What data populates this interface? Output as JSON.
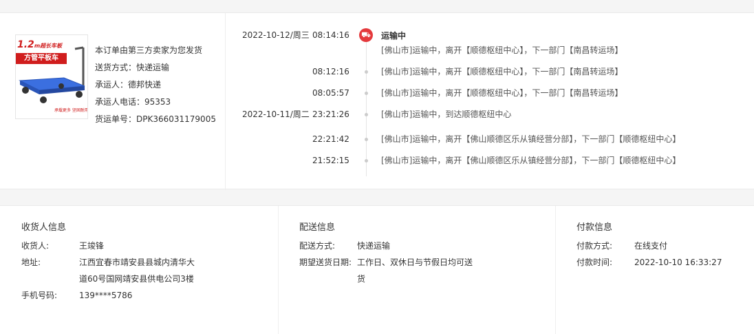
{
  "order": {
    "seller_note": "本订单由第三方卖家为您发货",
    "ship_method": "送货方式：快递运输",
    "carrier": "承运人：德邦快递",
    "carrier_phone": "承运人电话：95353",
    "tracking_no": "货运单号：DPK366031179005",
    "thumb_title": "1.2",
    "thumb_title_unit": "m超长车板",
    "thumb_band": "方管平板车",
    "thumb_caption": "承载更多 坚固耐用"
  },
  "tracking": {
    "current_status": "运输中",
    "events": [
      {
        "date": "2022-10-12/周三",
        "time": "08:14:16",
        "msg": "[佛山市]运输中，离开【顺德枢纽中心】，下一部门【南昌转运场】"
      },
      {
        "date": "",
        "time": "08:12:16",
        "msg": "[佛山市]运输中，离开【顺德枢纽中心】，下一部门【南昌转运场】"
      },
      {
        "date": "",
        "time": "08:05:57",
        "msg": "[佛山市]运输中，离开【顺德枢纽中心】，下一部门【南昌转运场】"
      },
      {
        "date": "2022-10-11/周二",
        "time": "23:21:26",
        "msg": "[佛山市]运输中，到达顺德枢纽中心"
      },
      {
        "date": "",
        "time": "22:21:42",
        "msg": "[佛山市]运输中，离开【佛山顺德区乐从镇经营分部】，下一部门【顺德枢纽中心】"
      },
      {
        "date": "",
        "time": "21:52:15",
        "msg": "[佛山市]运输中，离开【佛山顺德区乐从镇经营分部】，下一部门【顺德枢纽中心】"
      }
    ]
  },
  "receiver": {
    "title": "收货人信息",
    "name_label": "收货人:",
    "name": "王竣锋",
    "addr_label": "地址:",
    "addr_line1": "江西宜春市靖安县县城内清华大",
    "addr_line2": "道60号国网靖安县供电公司3楼",
    "phone_label": "手机号码:",
    "phone": "139****5786"
  },
  "delivery": {
    "title": "配送信息",
    "method_label": "配送方式:",
    "method": "快递运输",
    "date_label": "期望送货日期:",
    "date_line1": "工作日、双休日与节假日均可送",
    "date_line2": "货"
  },
  "payment": {
    "title": "付款信息",
    "method_label": "付款方式:",
    "method": "在线支付",
    "time_label": "付款时间:",
    "time": "2022-10-10 16:33:27"
  },
  "colors": {
    "accent": "#e4393c",
    "brand_red": "#d01d1d"
  }
}
